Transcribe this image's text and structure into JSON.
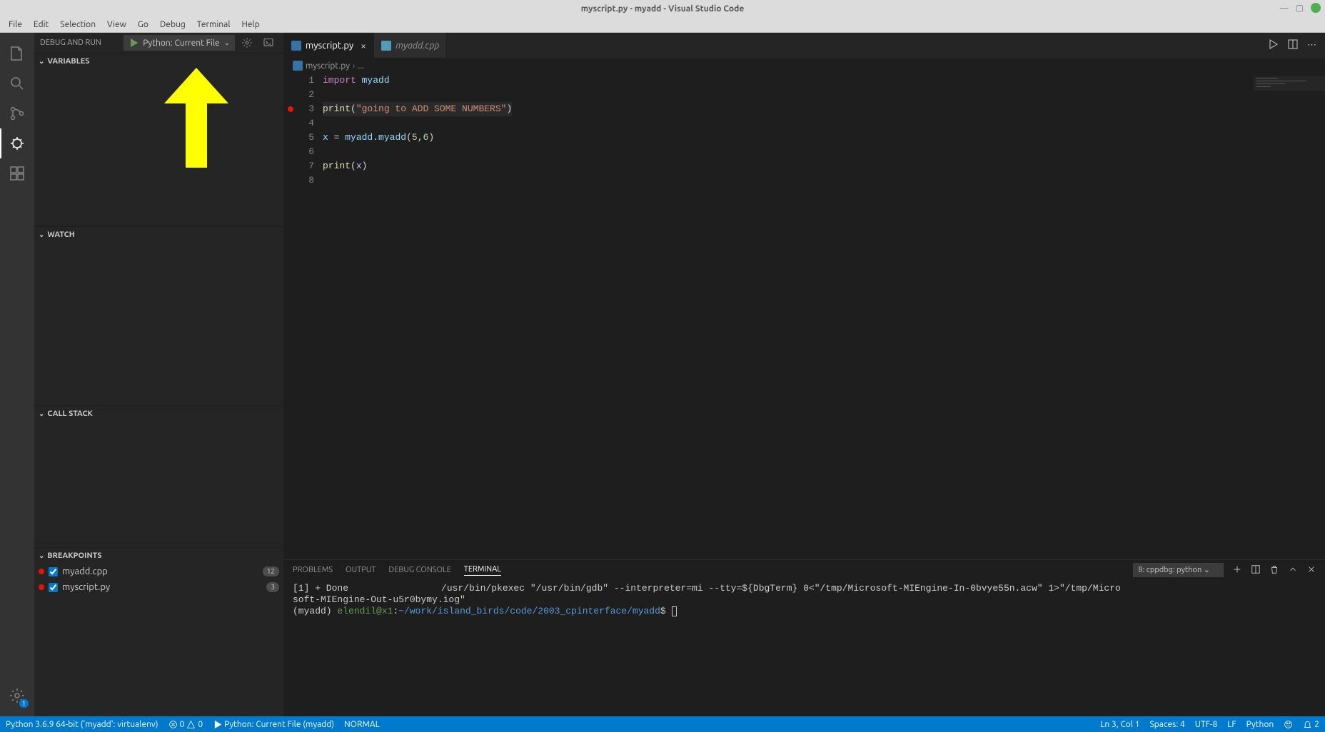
{
  "window": {
    "title": "myscript.py - myadd - Visual Studio Code"
  },
  "menubar": [
    "File",
    "Edit",
    "Selection",
    "View",
    "Go",
    "Debug",
    "Terminal",
    "Help"
  ],
  "activitybar": {
    "settings_badge": "1"
  },
  "sidebar": {
    "title": "DEBUG AND RUN",
    "debug_config": "Python: Current File",
    "sections": {
      "variables": "VARIABLES",
      "watch": "WATCH",
      "callstack": "CALL STACK",
      "breakpoints": "BREAKPOINTS"
    },
    "breakpoints": [
      {
        "file": "myadd.cpp",
        "count": "12"
      },
      {
        "file": "myscript.py",
        "count": "3"
      }
    ]
  },
  "tabs": [
    {
      "name": "myscript.py",
      "active": true,
      "lang": "py"
    },
    {
      "name": "myadd.cpp",
      "active": false,
      "lang": "cpp"
    }
  ],
  "breadcrumbs": {
    "file": "myscript.py",
    "rest": "..."
  },
  "code": {
    "lines": [
      {
        "n": 1,
        "bp": false,
        "tokens": [
          [
            "kw",
            "import"
          ],
          [
            "",
            ": "
          ],
          [
            "id",
            "myadd"
          ]
        ],
        "raw": "import myadd"
      },
      {
        "n": 2,
        "bp": false,
        "raw": ""
      },
      {
        "n": 3,
        "bp": true,
        "raw": "print(\"going to ADD SOME NUMBERS\")"
      },
      {
        "n": 4,
        "bp": false,
        "raw": ""
      },
      {
        "n": 5,
        "bp": false,
        "raw": "x = myadd.myadd(5,6)"
      },
      {
        "n": 6,
        "bp": false,
        "raw": ""
      },
      {
        "n": 7,
        "bp": false,
        "raw": "print(x)"
      },
      {
        "n": 8,
        "bp": false,
        "raw": ""
      }
    ]
  },
  "panel": {
    "tabs": [
      "PROBLEMS",
      "OUTPUT",
      "DEBUG CONSOLE",
      "TERMINAL"
    ],
    "active": "TERMINAL",
    "terminal_selector": "8: cppdbg: python",
    "terminal_line1_a": "[1] + Done",
    "terminal_line1_b": "/usr/bin/pkexec \"/usr/bin/gdb\" --interpreter=mi --tty=${DbgTerm} 0<\"/tmp/Microsoft-MIEngine-In-0bvye55n.acw\" 1>\"/tmp/Micro",
    "terminal_line2": "soft-MIEngine-Out-u5r0bymy.iog\"",
    "terminal_prompt_env": "(myadd) ",
    "terminal_prompt_user": "elendil@x1",
    "terminal_prompt_sep": ":",
    "terminal_prompt_path": "~/work/island_birds/code/2003_cpinterface/myadd",
    "terminal_prompt_end": "$ "
  },
  "statusbar": {
    "python": "Python 3.6.9 64-bit ('myadd': virtualenv)",
    "errors": "0",
    "warnings": "0",
    "debug": "Python: Current File (myadd)",
    "mode": "NORMAL",
    "position": "Ln 3, Col 1",
    "spaces": "Spaces: 4",
    "encoding": "UTF-8",
    "eol": "LF",
    "lang": "Python",
    "feedback": "2"
  }
}
